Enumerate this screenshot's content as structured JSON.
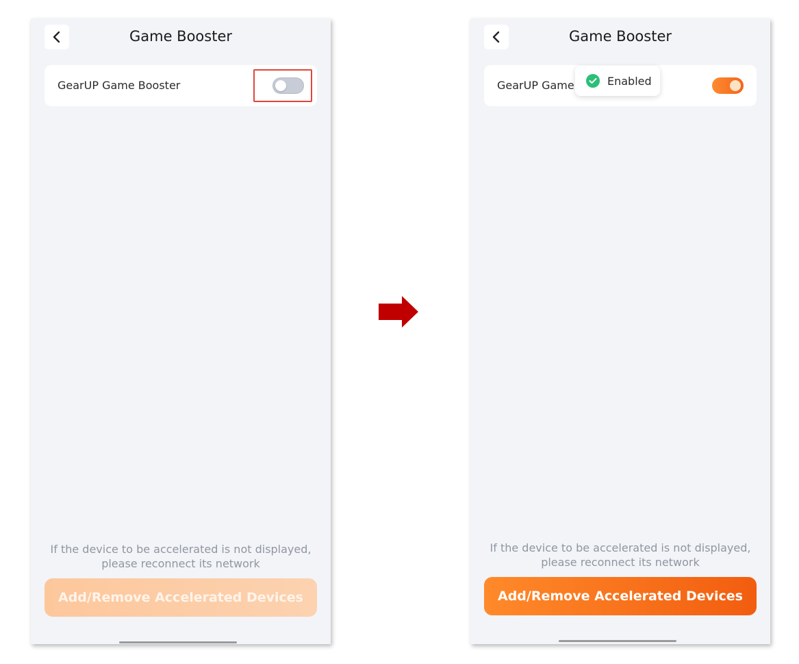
{
  "before": {
    "header": {
      "title": "Game Booster"
    },
    "booster_row": {
      "label": "GearUP Game Booster",
      "toggle_state": "off"
    },
    "hint": {
      "line1": "If the device to be accelerated is not displayed,",
      "line2": "please reconnect its network"
    },
    "action_button": {
      "label": "Add/Remove Accelerated Devices",
      "state": "disabled"
    }
  },
  "after": {
    "header": {
      "title": "Game Booster"
    },
    "booster_row": {
      "label": "GearUP Game",
      "toggle_state": "on"
    },
    "toast": {
      "text": "Enabled",
      "icon": "check-circle-icon"
    },
    "hint": {
      "line1": "If the device to be accelerated is not displayed,",
      "line2": "please reconnect its network"
    },
    "action_button": {
      "label": "Add/Remove Accelerated Devices",
      "state": "enabled"
    }
  },
  "colors": {
    "accent": "#f2661c",
    "highlight": "#e0453a",
    "arrow": "#c00000",
    "toast_check": "#2bbf77",
    "background": "#f2f4f8"
  },
  "icons": {
    "back": "chevron-left-icon",
    "arrow": "right-arrow-icon"
  }
}
